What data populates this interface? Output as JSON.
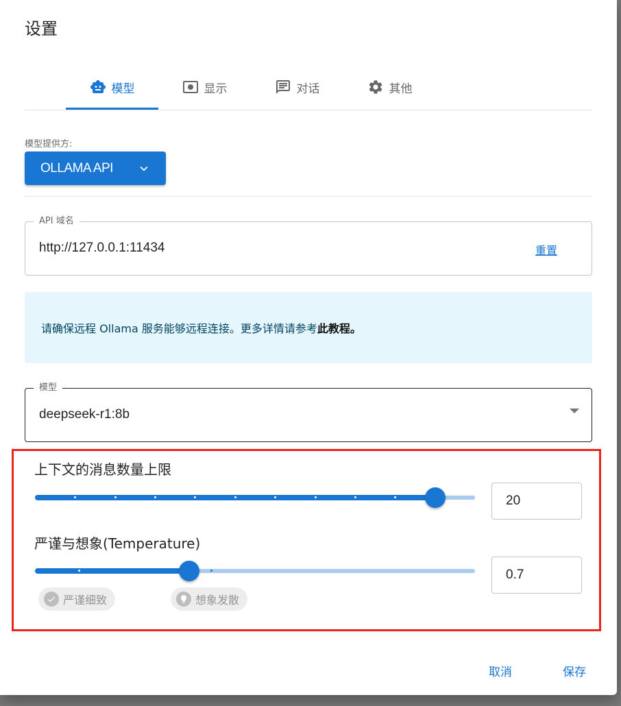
{
  "dialog": {
    "title": "设置"
  },
  "tabs": [
    {
      "label": "模型",
      "icon": "robot-icon",
      "active": true
    },
    {
      "label": "显示",
      "icon": "display-icon",
      "active": false
    },
    {
      "label": "对话",
      "icon": "chat-icon",
      "active": false
    },
    {
      "label": "其他",
      "icon": "gear-icon",
      "active": false
    }
  ],
  "provider": {
    "label": "模型提供方:",
    "value": "OLLAMA API"
  },
  "api_host": {
    "legend": "API 域名",
    "value": "http://127.0.0.1:11434",
    "reset_label": "重置"
  },
  "alert": {
    "text": "请确保远程 Ollama 服务能够远程连接。更多详情请参考",
    "link_text": "此教程",
    "suffix": "。"
  },
  "model_select": {
    "legend": "模型",
    "value": "deepseek-r1:8b"
  },
  "context_limit": {
    "label": "上下文的消息数量上限",
    "value": "20",
    "slider_fraction": 0.91,
    "ticks": 11
  },
  "temperature": {
    "label": "严谨与想象(Temperature)",
    "value": "0.7",
    "slider_fraction": 0.35,
    "chip_precise": "严谨细致",
    "chip_imaginative": "想象发散"
  },
  "actions": {
    "cancel": "取消",
    "save": "保存"
  },
  "colors": {
    "primary": "#1976d2",
    "alert_bg": "#e5f6fd",
    "highlight": "#e8241b"
  }
}
